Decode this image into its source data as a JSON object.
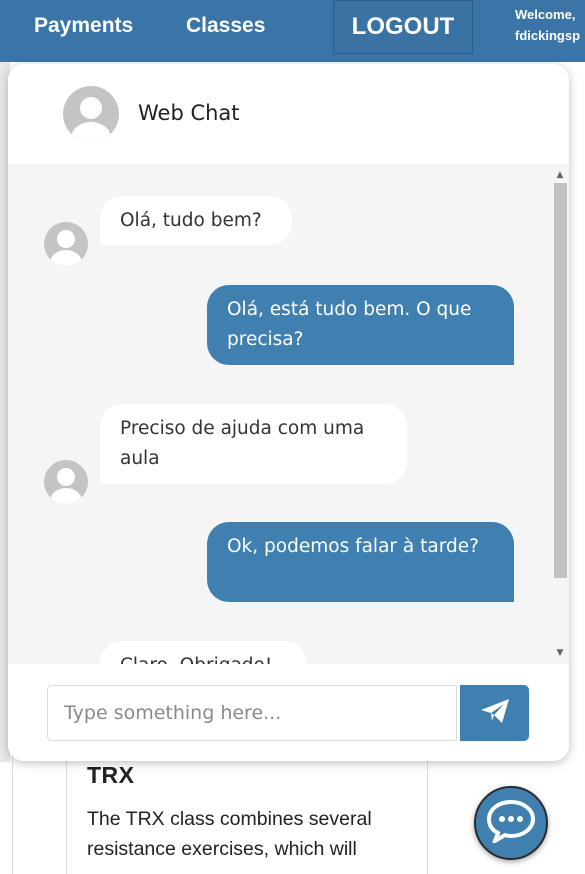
{
  "nav": {
    "payments": "Payments",
    "classes": "Classes",
    "logout": "LOGOUT",
    "welcome_line1": "Welcome,",
    "welcome_line2": "fdickingsp"
  },
  "chat": {
    "title": "Web Chat",
    "messages": [
      {
        "from": "agent",
        "text": "Olá, tudo bem?"
      },
      {
        "from": "user",
        "text": "Olá, está tudo bem. O que precisa?"
      },
      {
        "from": "agent",
        "text": "Preciso de ajuda com uma aula"
      },
      {
        "from": "user",
        "text": "Ok, podemos falar à tarde?"
      },
      {
        "from": "agent",
        "text": "Claro, Obrigado!"
      }
    ],
    "input_placeholder": "Type something here...",
    "input_value": ""
  },
  "background": {
    "card_title": "TRX",
    "card_text": "The TRX class combines several resistance exercises, which will"
  },
  "colors": {
    "nav_bg": "#3b75a8",
    "accent": "#3f80b0",
    "chat_bg": "#f5f5f5"
  },
  "icons": {
    "send": "paper-plane-icon",
    "fab": "chat-bubble-icon",
    "avatar": "user-avatar-icon"
  }
}
